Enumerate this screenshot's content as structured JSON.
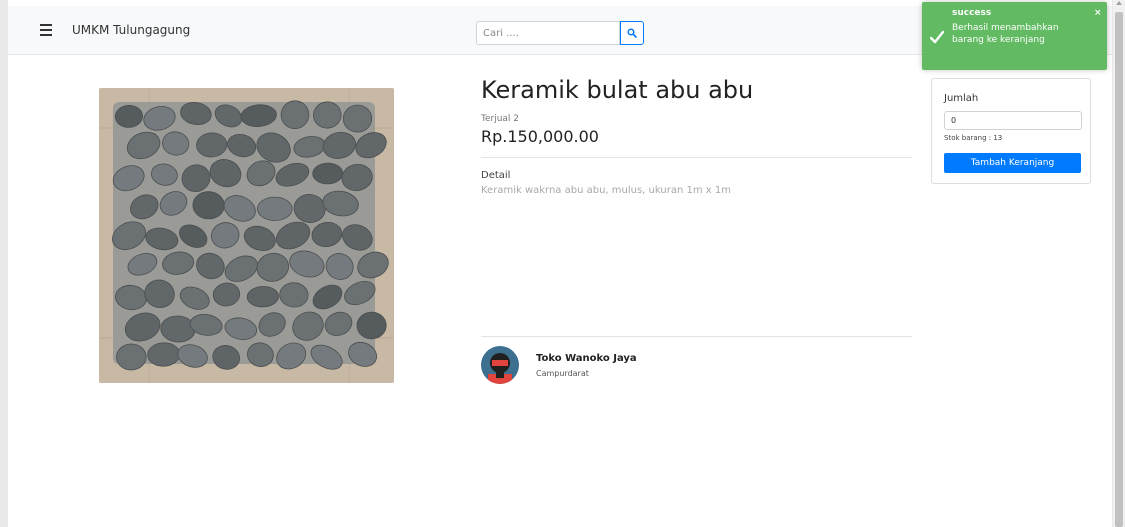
{
  "navbar": {
    "brand": "UMKM Tulungagung",
    "search_placeholder": "Cari ....",
    "menu_icon": "hamburger-icon",
    "search_icon": "search-icon"
  },
  "product": {
    "title": "Keramik bulat abu abu",
    "sold": "Terjual 2",
    "price": "Rp.150,000.00",
    "detail_label": "Detail",
    "detail_text": "Keramik wakrna abu abu, mulus, ukuran 1m x 1m"
  },
  "shop": {
    "name": "Toko Wanoko Jaya",
    "location": "Campurdarat"
  },
  "cart": {
    "quantity_label": "Jumlah",
    "quantity_value": "0",
    "stock": "Stok barang : 13",
    "add_button": "Tambah Keranjang"
  },
  "toast": {
    "title": "success",
    "message": "Berhasil menambahkan barang ke keranjang",
    "close": "×",
    "icon": "check-icon"
  },
  "colors": {
    "primary": "#007bff",
    "success": "#5cb85c"
  }
}
